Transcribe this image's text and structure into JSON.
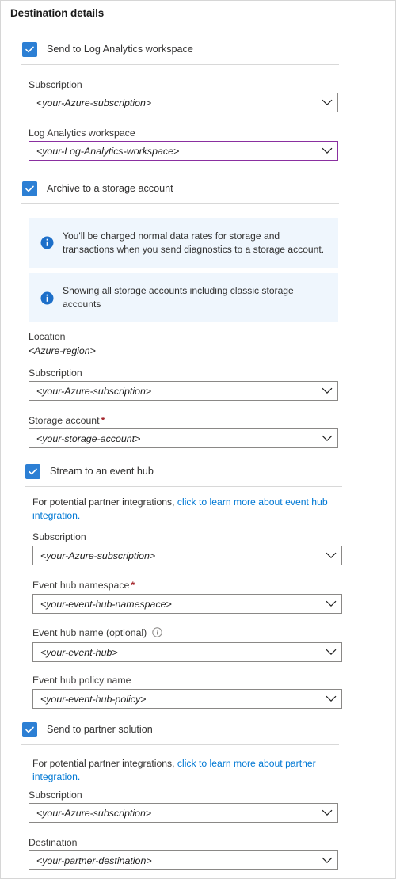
{
  "page": {
    "title": "Destination details",
    "accent_blue": "#2c7fd4",
    "link_blue": "#0078d4",
    "focus_purple": "#8a2fa0",
    "required_red": "#a4262c",
    "callout_bg": "#eff6fd"
  },
  "sections": {
    "log_analytics": {
      "checkbox": {
        "label": "Send to Log Analytics workspace",
        "checked": true
      },
      "subscription": {
        "label": "Subscription",
        "value": "<your-Azure-subscription>"
      },
      "workspace": {
        "label": "Log Analytics workspace",
        "value": "<your-Log-Analytics-workspace>",
        "focused": true
      }
    },
    "storage": {
      "checkbox": {
        "label": "Archive to a storage account",
        "checked": true
      },
      "callout_rates": "You'll be charged normal data rates for storage and transactions when you send diagnostics to a storage account.",
      "callout_classic": "Showing all storage accounts including classic storage accounts",
      "location": {
        "label": "Location",
        "value": "<Azure-region>"
      },
      "subscription": {
        "label": "Subscription",
        "value": "<your-Azure-subscription>"
      },
      "storage_account": {
        "label": "Storage account",
        "required_mark": "*",
        "value": "<your-storage-account>"
      }
    },
    "event_hub": {
      "checkbox": {
        "label": "Stream to an event hub",
        "checked": true
      },
      "note_prefix": "For potential partner integrations, ",
      "note_link": "click to learn more about event hub integration.",
      "subscription": {
        "label": "Subscription",
        "value": "<your-Azure-subscription>"
      },
      "namespace": {
        "label": "Event hub namespace",
        "required_mark": "*",
        "value": "<your-event-hub-namespace>"
      },
      "hub_name": {
        "label": "Event hub name (optional)",
        "value": "<your-event-hub>",
        "info_icon": "info-circle-icon"
      },
      "policy_name": {
        "label": "Event hub policy name",
        "value": "<your-event-hub-policy>"
      }
    },
    "partner": {
      "checkbox": {
        "label": "Send to partner solution",
        "checked": true
      },
      "note_prefix": "For potential partner integrations, ",
      "note_link": "click to learn more about partner integration.",
      "subscription": {
        "label": "Subscription",
        "value": "<your-Azure-subscription>"
      },
      "destination": {
        "label": "Destination",
        "value": "<your-partner-destination>"
      }
    }
  }
}
